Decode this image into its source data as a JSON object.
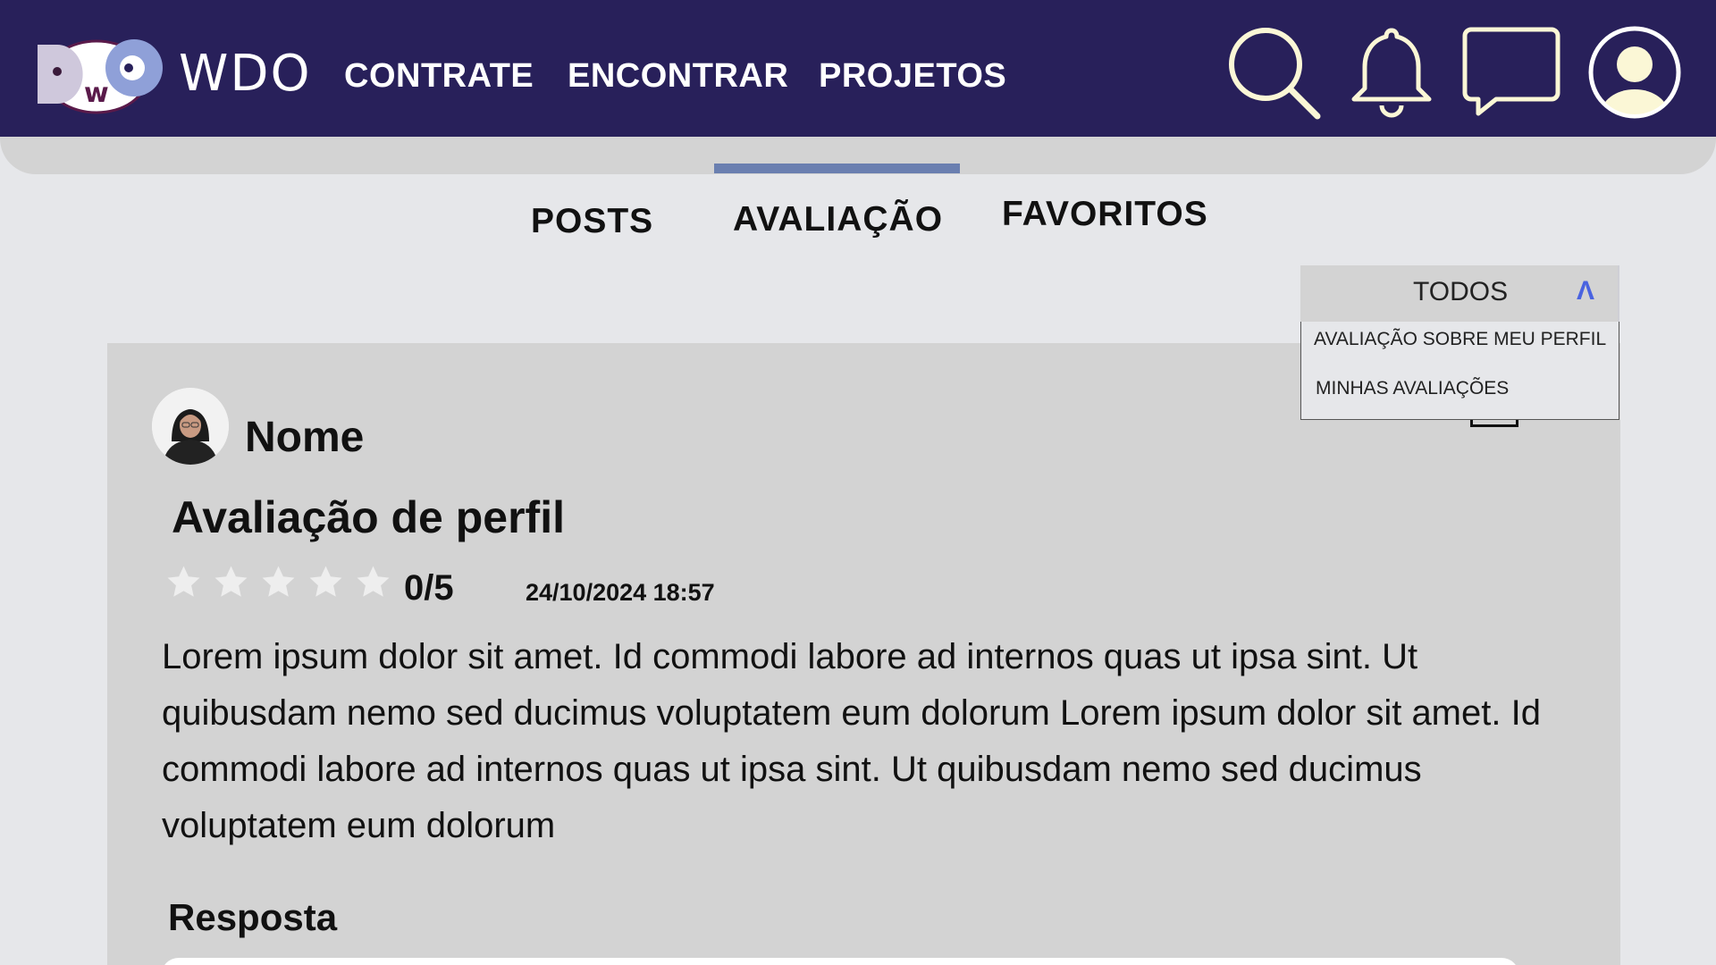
{
  "header": {
    "brand": "WDO",
    "logo_text": "DwO",
    "nav": [
      "CONTRATE",
      "ENCONTRAR",
      "PROJETOS"
    ],
    "icons": [
      "search-icon",
      "bell-icon",
      "chat-icon",
      "user-icon"
    ],
    "bg_color": "#28205a"
  },
  "tabs": {
    "items": [
      "POSTS",
      "AVALIAÇÃO",
      "FAVORITOS"
    ],
    "active": "AVALIAÇÃO",
    "indicator_color": "#6a7fb0"
  },
  "filter": {
    "selected": "TODOS",
    "options": [
      "AVALIAÇÃO SOBRE MEU PERFIL",
      "MINHAS AVALIAÇÕES"
    ],
    "chevron_color": "#4a63e0"
  },
  "review": {
    "author": "Nome",
    "title": "Avaliação de perfil",
    "rating": 0,
    "rating_max": 5,
    "score_label": "0/5",
    "date": "24/10/2024 18:57",
    "body": "Lorem ipsum dolor sit amet. Id commodi labore ad internos quas ut ipsa sint. Ut quibusdam nemo sed ducimus voluptatem eum dolorum Lorem ipsum dolor sit amet. Id commodi labore ad internos quas ut ipsa sint. Ut quibusdam nemo sed ducimus voluptatem eum dolorum",
    "answer_label": "Resposta"
  }
}
